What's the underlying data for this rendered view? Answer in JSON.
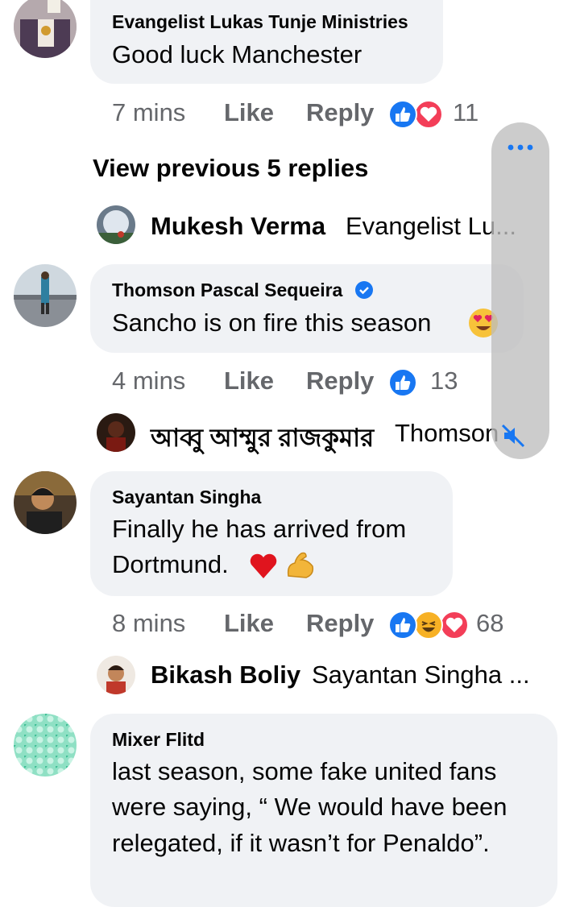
{
  "comments": [
    {
      "name": "Evangelist  Lukas Tunje Ministries",
      "text": "Good luck Manchester",
      "time": "7 mins",
      "like": "Like",
      "reply": "Reply",
      "reaction_count": "11",
      "reactions": [
        "like-icon",
        "love-icon"
      ]
    },
    {
      "name": "Thomson Pascal Sequeira",
      "verified": true,
      "text": "Sancho is on fire this season",
      "emoji": "heart-eyes-emoji",
      "time": "4 mins",
      "like": "Like",
      "reply": "Reply",
      "reaction_count": "13",
      "reactions": [
        "like-icon"
      ]
    },
    {
      "name": "Sayantan Singha",
      "text_line1": "Finally he has arrived from",
      "text_line2": "Dortmund.",
      "emojis": [
        "red-heart-emoji",
        "flexed-biceps-emoji"
      ],
      "time": "8 mins",
      "like": "Like",
      "reply": "Reply",
      "reaction_count": "68",
      "reactions": [
        "like-icon",
        "haha-icon",
        "love-icon"
      ]
    },
    {
      "name": "Mixer Flitd",
      "text_line1": "last season, some fake united fans",
      "text_line2": "were saying, “ We would have been",
      "text_line3": "relegated, if it wasn’t for Penaldo”."
    }
  ],
  "view_previous": "View previous 5 replies",
  "reply_previews": [
    {
      "name": "Mukesh Verma",
      "preview": "Evangelist  Lu..."
    },
    {
      "name": "আব্বু আম্মুর রাজকুমার",
      "preview": "Thomson"
    },
    {
      "name": "Bikash Boliy",
      "preview": "Sayantan Singha ..."
    }
  ],
  "overlay": {
    "icon": "more-dots-icon",
    "secondary_icon": "muted-speaker-icon"
  },
  "colors": {
    "bubble": "#f0f2f5",
    "secondary_text": "#65676b",
    "link_blue": "#1877f2",
    "love_red": "#f33e58",
    "haha_yellow": "#f7b125"
  }
}
